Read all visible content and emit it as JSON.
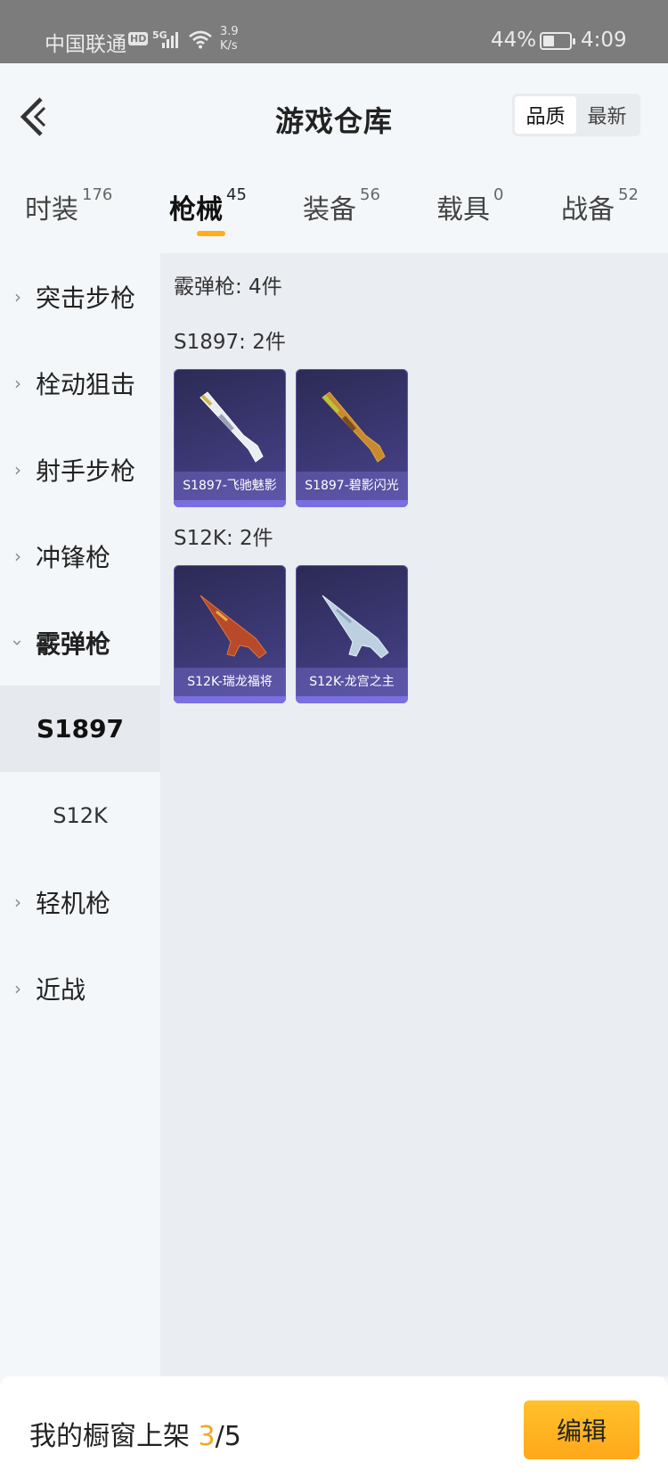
{
  "status_bar": {
    "carrier": "中国联通",
    "hd": "HD",
    "network": "5G",
    "speed_value": "3.9",
    "speed_unit": "K/s",
    "battery_percent": "44%",
    "battery_level": 0.44,
    "time": "4:09"
  },
  "header": {
    "title": "游戏仓库",
    "sort_options": [
      "品质",
      "最新"
    ],
    "sort_selected": "品质"
  },
  "tabs": [
    {
      "label": "时装",
      "count": "176"
    },
    {
      "label": "枪械",
      "count": "45"
    },
    {
      "label": "装备",
      "count": "56"
    },
    {
      "label": "载具",
      "count": "0"
    },
    {
      "label": "战备",
      "count": "52"
    }
  ],
  "active_tab": "枪械",
  "sidebar": {
    "categories": [
      {
        "label": "突击步枪"
      },
      {
        "label": "栓动狙击"
      },
      {
        "label": "射手步枪"
      },
      {
        "label": "冲锋枪"
      },
      {
        "label": "霰弹枪"
      },
      {
        "label": "轻机枪"
      },
      {
        "label": "近战"
      }
    ],
    "subcategories": [
      {
        "label": "S1897"
      },
      {
        "label": "S12K"
      }
    ],
    "expanded": "霰弹枪",
    "selected_sub": "S1897"
  },
  "content": {
    "summary": "霰弹枪: 4件",
    "groups": [
      {
        "title": "S1897: 2件",
        "items": [
          {
            "name": "S1897-飞驰魅影",
            "gun_icon": "shotgun-icon"
          },
          {
            "name": "S1897-碧影闪光",
            "gun_icon": "shotgun-icon"
          }
        ]
      },
      {
        "title": "S12K: 2件",
        "items": [
          {
            "name": "S12K-瑞龙福将",
            "gun_icon": "rifle-icon"
          },
          {
            "name": "S12K-龙宫之主",
            "gun_icon": "rifle-icon"
          }
        ]
      }
    ]
  },
  "bottom": {
    "showcase_label": "我的橱窗上架",
    "showcase_current": "3",
    "showcase_total": "/5",
    "edit_label": "编辑"
  },
  "colors": {
    "accent": "#ffae1a",
    "card_bg": "#3b3874",
    "highlight": "#f5a623"
  }
}
